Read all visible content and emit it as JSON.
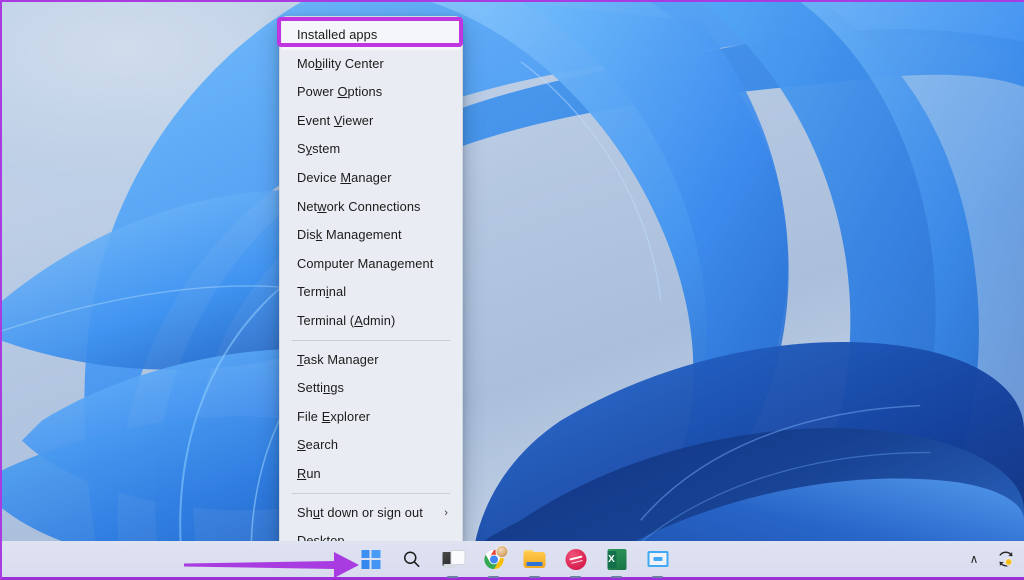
{
  "desktop": {
    "wallpaper_name": "windows-11-bloom-wallpaper",
    "background_color": "#b9cbe4",
    "accent_blue": "#2f7de1"
  },
  "annotation": {
    "highlight_color": "#bf35e0",
    "arrow_color": "#a93ce0",
    "border_color": "#a93ce0",
    "highlight_target": "Installed apps",
    "arrow_target": "Start button"
  },
  "context_menu": {
    "name": "win-x-power-user-menu",
    "background": "#e9ecf2",
    "groups": [
      {
        "items": [
          {
            "label": "Installed apps",
            "accel": "",
            "highlighted": true,
            "submenu": false
          },
          {
            "label": "Mobility Center",
            "accel": "b",
            "highlighted": false,
            "submenu": false
          },
          {
            "label": "Power Options",
            "accel": "O",
            "highlighted": false,
            "submenu": false
          },
          {
            "label": "Event Viewer",
            "accel": "V",
            "highlighted": false,
            "submenu": false
          },
          {
            "label": "System",
            "accel": "y",
            "highlighted": false,
            "submenu": false
          },
          {
            "label": "Device Manager",
            "accel": "M",
            "highlighted": false,
            "submenu": false
          },
          {
            "label": "Network Connections",
            "accel": "w",
            "highlighted": false,
            "submenu": false
          },
          {
            "label": "Disk Management",
            "accel": "k",
            "highlighted": false,
            "submenu": false
          },
          {
            "label": "Computer Management",
            "accel": "g",
            "highlighted": false,
            "submenu": false
          },
          {
            "label": "Terminal",
            "accel": "i",
            "highlighted": false,
            "submenu": false
          },
          {
            "label": "Terminal (Admin)",
            "accel": "A",
            "highlighted": false,
            "submenu": false
          }
        ]
      },
      {
        "items": [
          {
            "label": "Task Manager",
            "accel": "T",
            "highlighted": false,
            "submenu": false
          },
          {
            "label": "Settings",
            "accel": "n",
            "highlighted": false,
            "submenu": false
          },
          {
            "label": "File Explorer",
            "accel": "E",
            "highlighted": false,
            "submenu": false
          },
          {
            "label": "Search",
            "accel": "S",
            "highlighted": false,
            "submenu": false
          },
          {
            "label": "Run",
            "accel": "R",
            "highlighted": false,
            "submenu": false
          }
        ]
      },
      {
        "items": [
          {
            "label": "Shut down or sign out",
            "accel": "u",
            "highlighted": false,
            "submenu": true,
            "submenu_glyph": "›"
          },
          {
            "label": "Desktop",
            "accel": "D",
            "highlighted": false,
            "submenu": false
          }
        ]
      }
    ]
  },
  "taskbar": {
    "background": "#dde1f0",
    "items": [
      {
        "name": "start-button",
        "label": "Start",
        "icon": "windows-logo-icon",
        "active": false
      },
      {
        "name": "search-button",
        "label": "Search",
        "icon": "search-icon",
        "active": false
      },
      {
        "name": "task-view-button",
        "label": "Task View",
        "icon": "widgets-icon",
        "active": true
      },
      {
        "name": "chrome-button",
        "label": "Google Chrome",
        "icon": "chrome-icon",
        "active": true
      },
      {
        "name": "file-explorer-button",
        "label": "File Explorer",
        "icon": "folder-icon",
        "active": true
      },
      {
        "name": "red-app-button",
        "label": "App",
        "icon": "red-circle-icon",
        "active": true
      },
      {
        "name": "excel-button",
        "label": "Microsoft Excel",
        "icon": "excel-icon",
        "active": true
      },
      {
        "name": "blue-window-button",
        "label": "App Window",
        "icon": "blue-window-icon",
        "active": true
      }
    ],
    "tray": [
      {
        "name": "show-hidden-icons",
        "label": "Show hidden icons",
        "icon": "chevron-up-icon",
        "glyph": "∧"
      },
      {
        "name": "windows-update-icon",
        "label": "Windows Update available",
        "icon": "update-sync-icon"
      }
    ]
  }
}
